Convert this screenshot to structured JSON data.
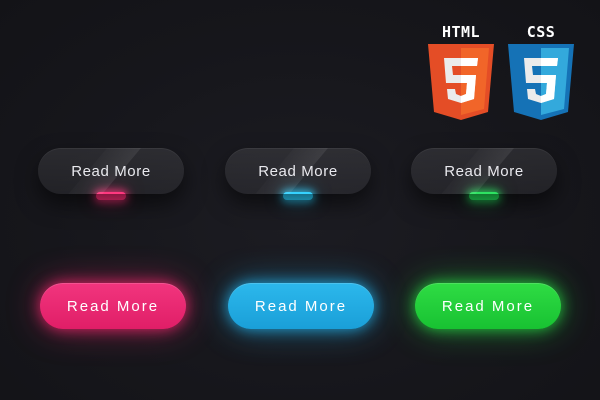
{
  "logos": {
    "html": {
      "text": "HTML",
      "icon": "html5-shield-icon",
      "color": "#e44d26"
    },
    "css": {
      "text": "CSS",
      "icon": "css3-shield-icon",
      "color": "#2965f1"
    }
  },
  "glass_buttons": [
    {
      "label": "Read More",
      "glow_color": "#ff2d78"
    },
    {
      "label": "Read More",
      "glow_color": "#2ad0ff"
    },
    {
      "label": "Read More",
      "glow_color": "#22e05a"
    }
  ],
  "neon_buttons": [
    {
      "label": "Read More",
      "color": "#e8266f"
    },
    {
      "label": "Read More",
      "color": "#22abe2"
    },
    {
      "label": "Read More",
      "color": "#1fcf3a"
    }
  ],
  "background_color": "#17171c"
}
